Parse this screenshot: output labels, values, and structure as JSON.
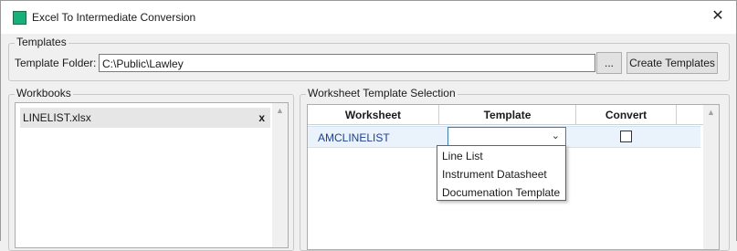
{
  "window": {
    "title": "Excel To Intermediate Conversion",
    "close_glyph": "✕"
  },
  "templates": {
    "legend": "Templates",
    "folder_label": "Template Folder:",
    "folder_value": "C:\\Public\\Lawley",
    "browse_label": "...",
    "create_label": "Create Templates"
  },
  "workbooks": {
    "legend": "Workbooks",
    "items": [
      {
        "label": "LINELIST.xlsx",
        "remove_glyph": "x"
      }
    ]
  },
  "worksheet_selection": {
    "legend": "Worksheet Template Selection",
    "columns": [
      "Worksheet",
      "Template",
      "Convert"
    ],
    "rows": [
      {
        "worksheet": "AMCLINELIST",
        "template": "",
        "convert": false
      }
    ],
    "dropdown_options": [
      "Line List",
      "Instrument Datasheet",
      "Documenation Template"
    ]
  },
  "icons": {
    "app": "app-icon",
    "close": "close-icon",
    "scroll_up": "scroll-up-arrow-icon",
    "chevron": "chevron-down-icon"
  }
}
